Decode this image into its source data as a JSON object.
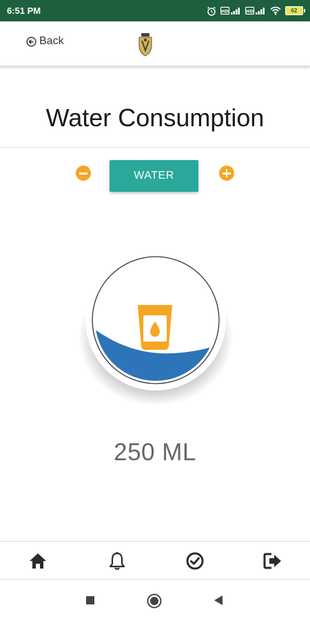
{
  "status_bar": {
    "time": "6:51 PM",
    "battery": "62",
    "icons": [
      "alarm-icon",
      "sim1-signal-icon",
      "sim2-signal-icon",
      "wifi-icon",
      "battery-icon"
    ]
  },
  "header": {
    "back_label": "Back",
    "logo": "crest-logo"
  },
  "page": {
    "title": "Water Consumption",
    "drink_button_label": "WATER",
    "amount": "250 ML",
    "fill_fraction": 0.45
  },
  "bottom_nav": {
    "items": [
      "home-icon",
      "bell-icon",
      "check-circle-icon",
      "logout-icon"
    ]
  },
  "system_nav": {
    "items": [
      "recents-square-icon",
      "home-circle-icon",
      "back-triangle-icon"
    ]
  },
  "colors": {
    "status_bar": "#1e5f3d",
    "accent_orange": "#f5a623",
    "teal": "#2aa89a",
    "water_blue": "#2d74b8"
  }
}
